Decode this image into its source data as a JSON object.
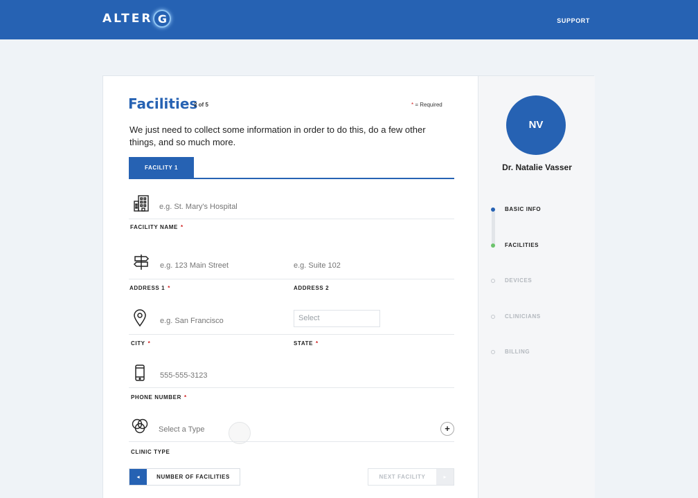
{
  "header": {
    "logo_text": "ALTER",
    "logo_g": "G",
    "support_label": "SUPPORT",
    "bar_color": "#2662b3"
  },
  "form": {
    "title": "Facilities",
    "step": "2 of 5",
    "required_star": "*",
    "required_text": "= Required",
    "intro": "We just need to collect some information in order to do this, do a few other things, and so much more.",
    "tab_label": "FACILITY 1",
    "facility_name": {
      "placeholder": "e.g. St. Mary's Hospital",
      "label": "FACILITY NAME",
      "icon": "building-icon"
    },
    "address1": {
      "placeholder": "e.g. 123 Main Street",
      "label": "ADDRESS 1",
      "icon": "signpost-icon"
    },
    "address2": {
      "placeholder": "e.g. Suite 102",
      "label": "ADDRESS 2"
    },
    "city": {
      "placeholder": "e.g. San Francisco",
      "label": "CITY",
      "icon": "location-pin-icon"
    },
    "state": {
      "placeholder": "Select",
      "label": "STATE"
    },
    "phone": {
      "placeholder": "555-555-3123",
      "label": "PHONE NUMBER",
      "icon": "phone-icon"
    },
    "clinic_type": {
      "placeholder": "Select a Type",
      "label": "CLINIC TYPE",
      "icon": "venn-circles-icon"
    },
    "add_symbol": "+",
    "prev_arrow": "◂",
    "number_of_facilities_label": "NUMBER OF FACILITIES",
    "next_facility_label": "NEXT FACILITY",
    "next_arrow": "▸"
  },
  "profile": {
    "initials": "NV",
    "name": "Dr. Natalie Vasser",
    "steps": [
      {
        "label": "BASIC INFO",
        "state": "done"
      },
      {
        "label": "FACILITIES",
        "state": "current"
      },
      {
        "label": "DEVICES",
        "state": "pending"
      },
      {
        "label": "CLINICIANS",
        "state": "pending"
      },
      {
        "label": "BILLING",
        "state": "pending"
      }
    ]
  }
}
